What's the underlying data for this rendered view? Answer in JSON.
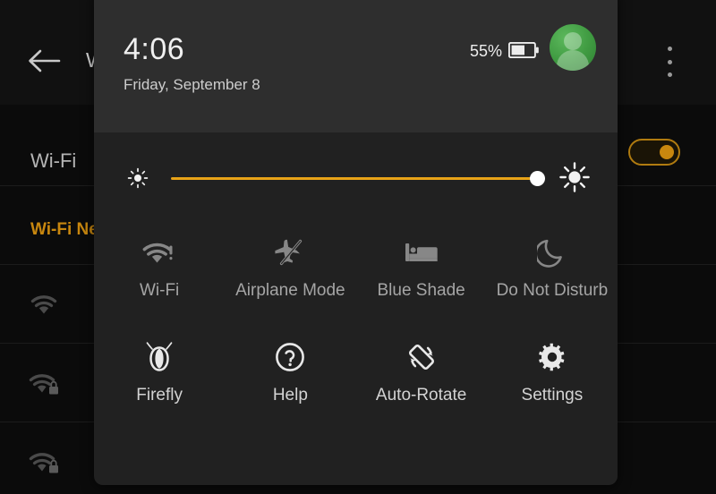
{
  "background": {
    "app_bar": {
      "back_icon": "back-arrow-icon",
      "title": "Wi-Fi",
      "overflow_icon": "overflow-menu-icon"
    },
    "wifi_row": {
      "label": "Wi-Fi",
      "toggle_state": "on",
      "toggle_color": "#c8870f"
    },
    "section_header": "Wi-Fi Networks",
    "accent_color": "#c8870f",
    "networks": [
      {
        "icon": "wifi-signal-icon",
        "name": ""
      },
      {
        "icon": "wifi-signal-lock-icon",
        "name": ""
      },
      {
        "icon": "wifi-signal-lock-icon",
        "name": ""
      }
    ]
  },
  "panel": {
    "header": {
      "time": "4:06",
      "date": "Friday, September 8",
      "battery_percent": "55%",
      "battery_icon": "battery-icon",
      "battery_level": 55,
      "avatar_icon": "user-avatar-icon",
      "avatar_color": "#3f9a41"
    },
    "brightness": {
      "low_icon": "brightness-low-icon",
      "high_icon": "brightness-high-icon",
      "value": 100,
      "track_color": "#e8a317",
      "thumb_color": "#ffffff"
    },
    "tiles": [
      [
        {
          "icon": "wifi-alert-icon",
          "label": "Wi-Fi"
        },
        {
          "icon": "airplane-off-icon",
          "label": "Airplane Mode"
        },
        {
          "icon": "bed-icon",
          "label": "Blue Shade"
        },
        {
          "icon": "moon-icon",
          "label": "Do Not Disturb"
        }
      ],
      [
        {
          "icon": "firefly-icon",
          "label": "Firefly"
        },
        {
          "icon": "help-circle-icon",
          "label": "Help"
        },
        {
          "icon": "auto-rotate-icon",
          "label": "Auto-Rotate"
        },
        {
          "icon": "gear-icon",
          "label": "Settings"
        }
      ]
    ]
  }
}
